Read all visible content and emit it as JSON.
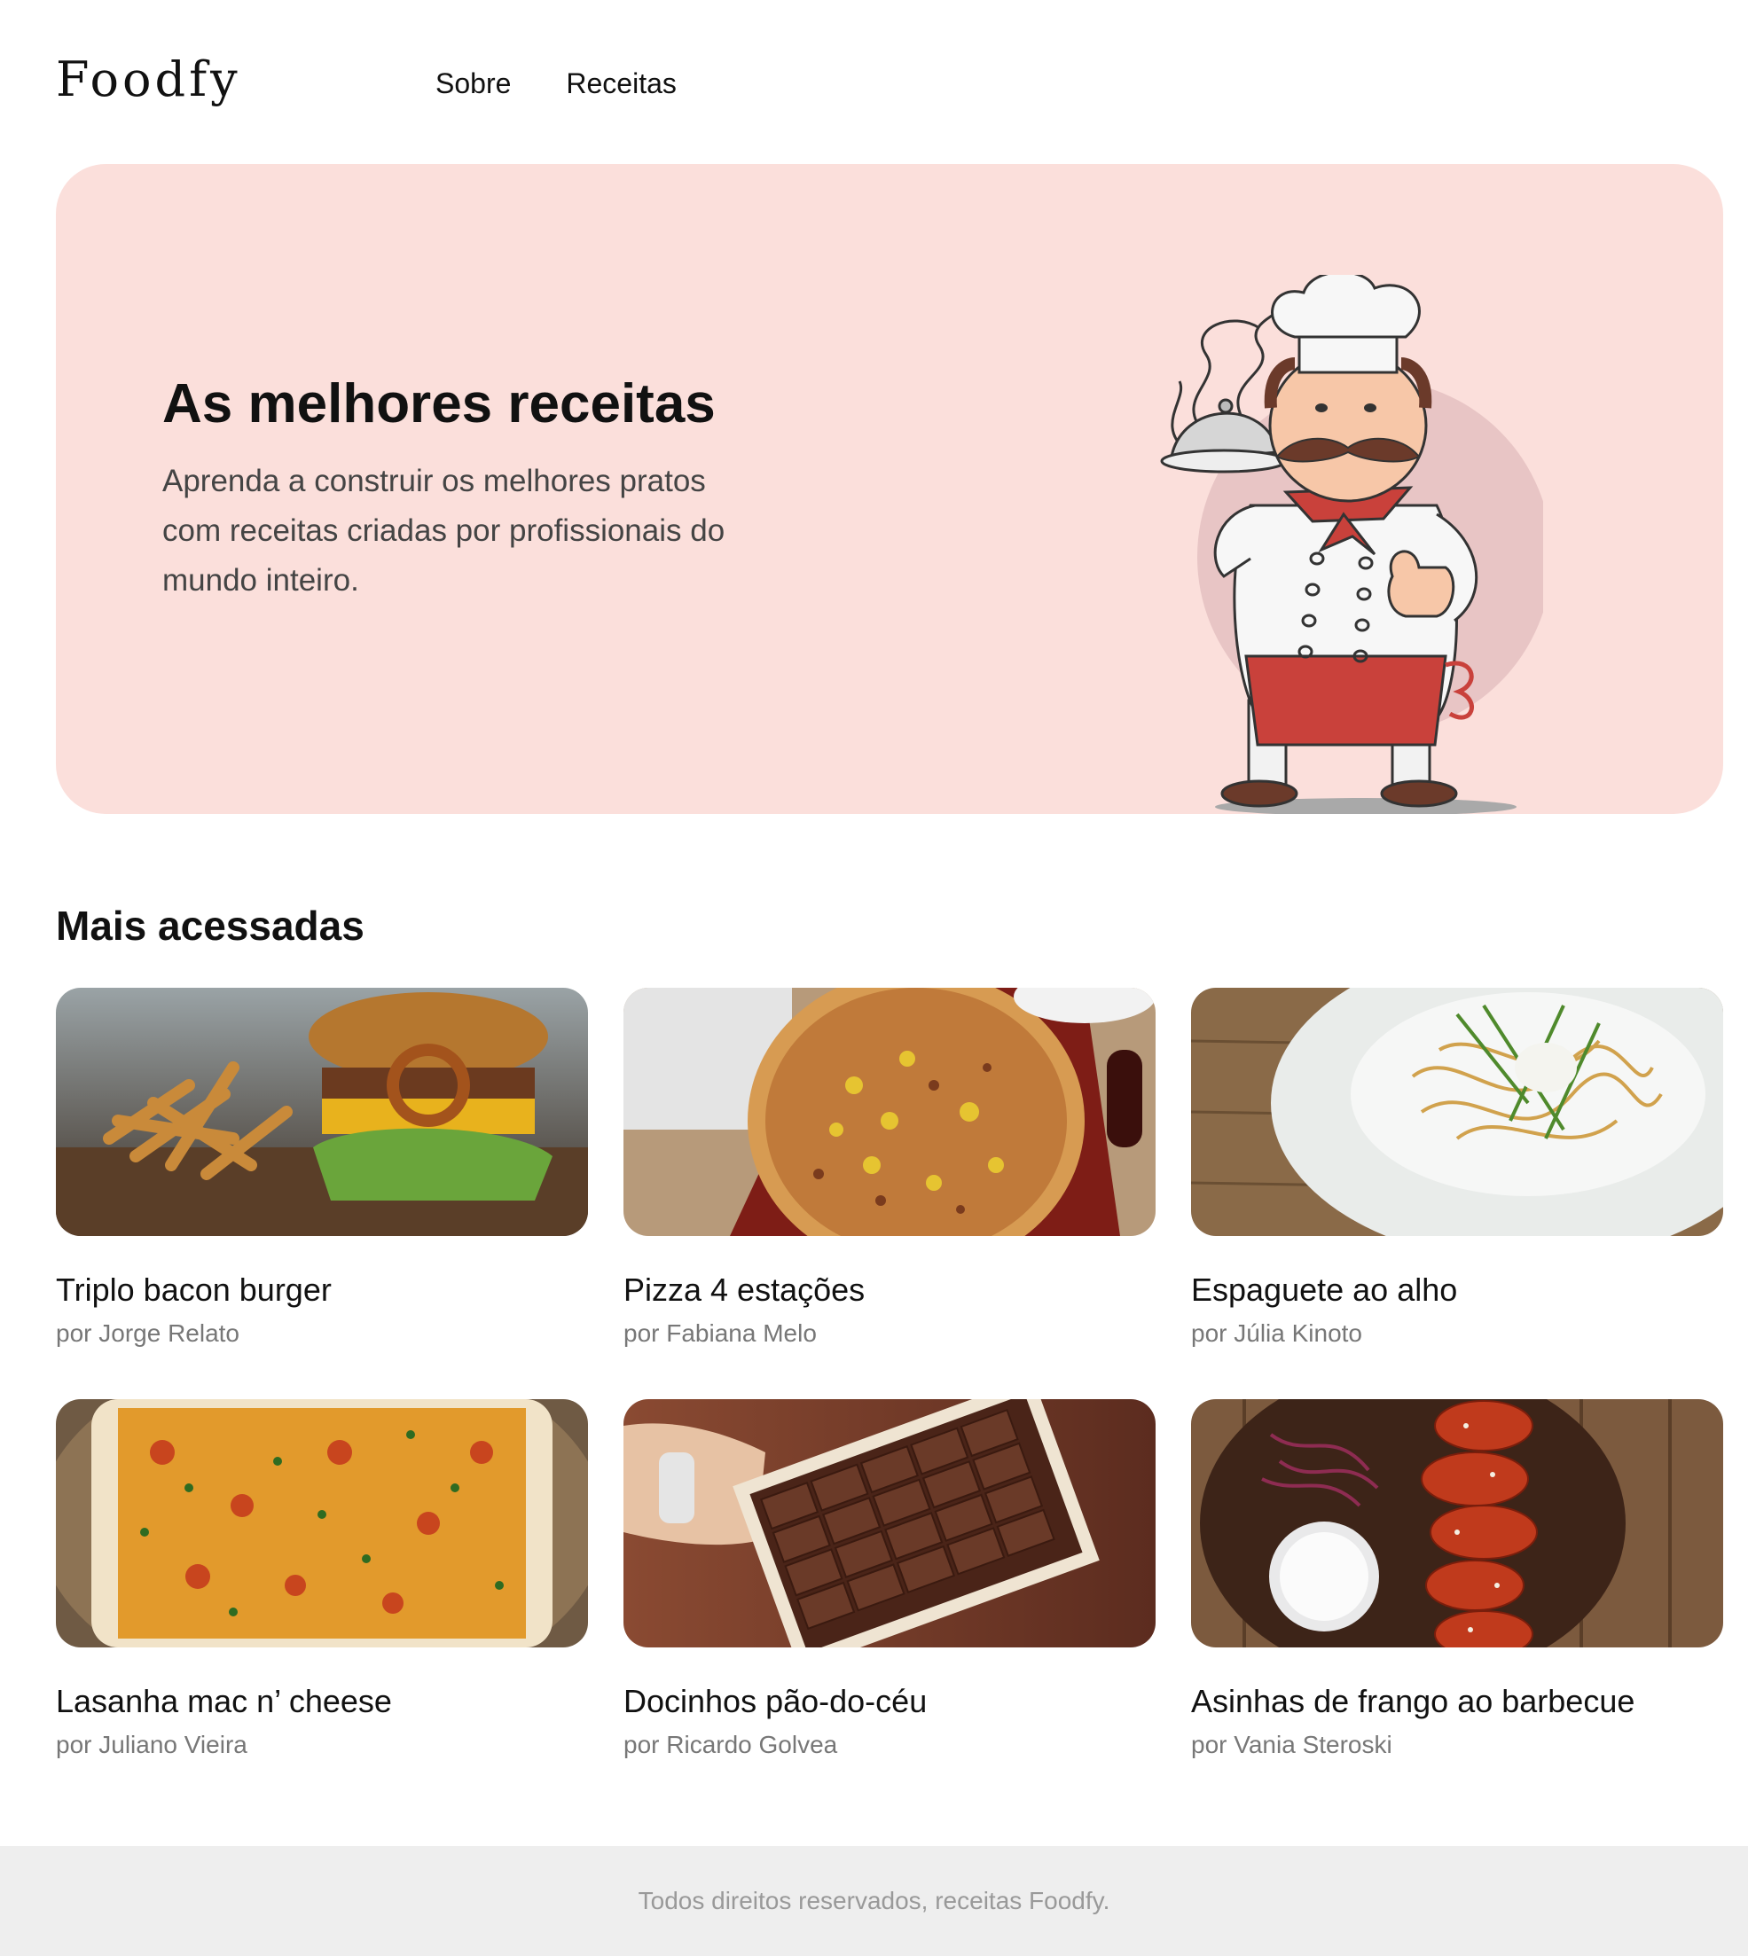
{
  "header": {
    "logo": "Foodfy",
    "nav": [
      "Sobre",
      "Receitas"
    ]
  },
  "hero": {
    "title": "As melhores receitas",
    "text": "Aprenda a construir os melhores pratos com receitas criadas por profissionais do mundo inteiro.",
    "illustration": "chef-illustration"
  },
  "section": {
    "title": "Mais acessadas"
  },
  "recipes": [
    {
      "name": "Triplo bacon burger",
      "author": "por Jorge Relato"
    },
    {
      "name": "Pizza 4 estações",
      "author": "por Fabiana Melo"
    },
    {
      "name": "Espaguete ao alho",
      "author": "por Júlia Kinoto"
    },
    {
      "name": "Lasanha mac n’ cheese",
      "author": "por Juliano Vieira"
    },
    {
      "name": "Docinhos pão-do-céu",
      "author": "por Ricardo Golvea"
    },
    {
      "name": "Asinhas de frango ao barbecue",
      "author": "por Vania Steroski"
    }
  ],
  "footer": {
    "text": "Todos direitos reservados, receitas Foodfy."
  },
  "colors": {
    "hero_bg": "#fbdfdb",
    "footer_bg": "#eeeeee",
    "author_text": "#777777"
  }
}
